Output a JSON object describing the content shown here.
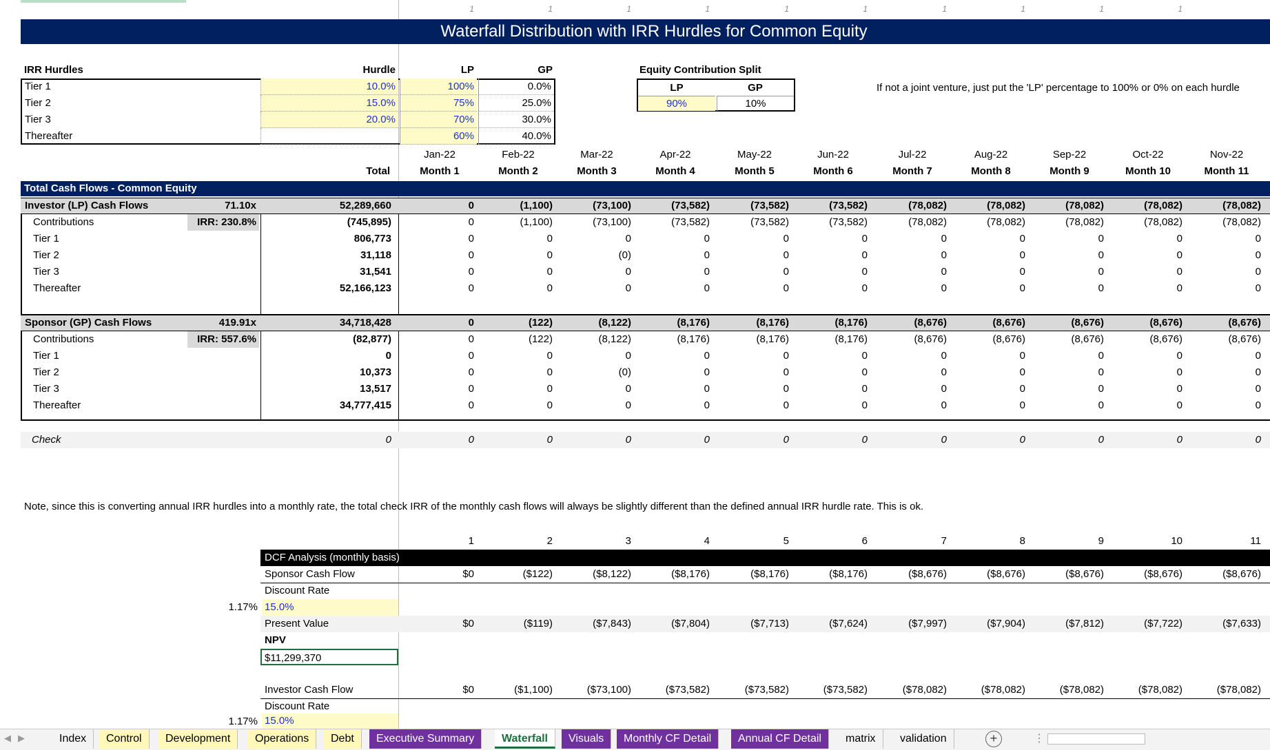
{
  "top_markers": [
    "1",
    "1",
    "1",
    "1",
    "1",
    "1",
    "1",
    "1",
    "1",
    "1"
  ],
  "title": "Waterfall Distribution with IRR Hurdles for Common Equity",
  "hurdles": {
    "header": {
      "label": "IRR Hurdles",
      "hurdle": "Hurdle",
      "lp": "LP",
      "gp": "GP"
    },
    "rows": [
      {
        "label": "Tier 1",
        "hurdle": "10.0%",
        "lp": "100%",
        "gp": "0.0%"
      },
      {
        "label": "Tier 2",
        "hurdle": "15.0%",
        "lp": "75%",
        "gp": "25.0%"
      },
      {
        "label": "Tier 3",
        "hurdle": "20.0%",
        "lp": "70%",
        "gp": "30.0%"
      },
      {
        "label": "Thereafter",
        "hurdle": "",
        "lp": "60%",
        "gp": "40.0%"
      }
    ]
  },
  "split": {
    "title": "Equity Contribution Split",
    "lp_label": "LP",
    "gp_label": "GP",
    "lp": "90%",
    "gp": "10%"
  },
  "note_jv": "If not a joint venture, just put the 'LP' percentage to 100% or 0% on each hurdle",
  "months": [
    "Jan-22",
    "Feb-22",
    "Mar-22",
    "Apr-22",
    "May-22",
    "Jun-22",
    "Jul-22",
    "Aug-22",
    "Sep-22",
    "Oct-22",
    "Nov-22"
  ],
  "month_labels": [
    "Month 1",
    "Month 2",
    "Month 3",
    "Month 4",
    "Month 5",
    "Month 6",
    "Month 7",
    "Month 8",
    "Month 9",
    "Month 10",
    "Month 11"
  ],
  "total_label": "Total",
  "section_title": "Total Cash Flows - Common Equity",
  "lp": {
    "header": {
      "label": "Investor (LP) Cash Flows",
      "multiple": "71.10x",
      "total": "52,289,660",
      "values": [
        "0",
        "(1,100)",
        "(73,100)",
        "(73,582)",
        "(73,582)",
        "(73,582)",
        "(78,082)",
        "(78,082)",
        "(78,082)",
        "(78,082)",
        "(78,082)"
      ]
    },
    "irr": "IRR: 230.8%",
    "rows": [
      {
        "label": "Contributions",
        "total": "(745,895)",
        "values": [
          "0",
          "(1,100)",
          "(73,100)",
          "(73,582)",
          "(73,582)",
          "(73,582)",
          "(78,082)",
          "(78,082)",
          "(78,082)",
          "(78,082)",
          "(78,082)"
        ]
      },
      {
        "label": "Tier 1",
        "total": "806,773",
        "values": [
          "0",
          "0",
          "0",
          "0",
          "0",
          "0",
          "0",
          "0",
          "0",
          "0",
          "0"
        ]
      },
      {
        "label": "Tier 2",
        "total": "31,118",
        "values": [
          "0",
          "0",
          "(0)",
          "0",
          "0",
          "0",
          "0",
          "0",
          "0",
          "0",
          "0"
        ]
      },
      {
        "label": "Tier 3",
        "total": "31,541",
        "values": [
          "0",
          "0",
          "0",
          "0",
          "0",
          "0",
          "0",
          "0",
          "0",
          "0",
          "0"
        ]
      },
      {
        "label": "Thereafter",
        "total": "52,166,123",
        "values": [
          "0",
          "0",
          "0",
          "0",
          "0",
          "0",
          "0",
          "0",
          "0",
          "0",
          "0"
        ]
      }
    ]
  },
  "gp": {
    "header": {
      "label": "Sponsor (GP) Cash Flows",
      "multiple": "419.91x",
      "total": "34,718,428",
      "values": [
        "0",
        "(122)",
        "(8,122)",
        "(8,176)",
        "(8,176)",
        "(8,176)",
        "(8,676)",
        "(8,676)",
        "(8,676)",
        "(8,676)",
        "(8,676)"
      ]
    },
    "irr": "IRR: 557.6%",
    "rows": [
      {
        "label": "Contributions",
        "total": "(82,877)",
        "values": [
          "0",
          "(122)",
          "(8,122)",
          "(8,176)",
          "(8,176)",
          "(8,176)",
          "(8,676)",
          "(8,676)",
          "(8,676)",
          "(8,676)",
          "(8,676)"
        ]
      },
      {
        "label": "Tier 1",
        "total": "0",
        "values": [
          "0",
          "0",
          "0",
          "0",
          "0",
          "0",
          "0",
          "0",
          "0",
          "0",
          "0"
        ]
      },
      {
        "label": "Tier 2",
        "total": "10,373",
        "values": [
          "0",
          "0",
          "(0)",
          "0",
          "0",
          "0",
          "0",
          "0",
          "0",
          "0",
          "0"
        ]
      },
      {
        "label": "Tier 3",
        "total": "13,517",
        "values": [
          "0",
          "0",
          "0",
          "0",
          "0",
          "0",
          "0",
          "0",
          "0",
          "0",
          "0"
        ]
      },
      {
        "label": "Thereafter",
        "total": "34,777,415",
        "values": [
          "0",
          "0",
          "0",
          "0",
          "0",
          "0",
          "0",
          "0",
          "0",
          "0",
          "0"
        ]
      }
    ]
  },
  "check": {
    "label": "Check",
    "total": "0",
    "values": [
      "0",
      "0",
      "0",
      "0",
      "0",
      "0",
      "0",
      "0",
      "0",
      "0",
      "0"
    ]
  },
  "note_irr": "Note, since this is converting annual IRR hurdles into a monthly rate, the total check IRR of the monthly cash flows will always be slightly different than the defined annual IRR hurdle rate. This is ok.",
  "period_numbers": [
    "1",
    "2",
    "3",
    "4",
    "5",
    "6",
    "7",
    "8",
    "9",
    "10",
    "11"
  ],
  "dcf": {
    "title": "DCF Analysis (monthly basis)",
    "sponsor_label": "Sponsor Cash Flow",
    "sponsor_values": [
      "$0",
      "($122)",
      "($8,122)",
      "($8,176)",
      "($8,176)",
      "($8,176)",
      "($8,676)",
      "($8,676)",
      "($8,676)",
      "($8,676)",
      "($8,676)"
    ],
    "discount_label": "Discount Rate",
    "monthly_rate": "1.17%",
    "discount_rate": "15.0%",
    "pv_label": "Present Value",
    "pv_values": [
      "$0",
      "($119)",
      "($7,843)",
      "($7,804)",
      "($7,713)",
      "($7,624)",
      "($7,997)",
      "($7,904)",
      "($7,812)",
      "($7,722)",
      "($7,633)"
    ],
    "npv_label": "NPV",
    "npv_value": "$11,299,370",
    "investor_label": "Investor Cash Flow",
    "investor_values": [
      "$0",
      "($1,100)",
      "($73,100)",
      "($73,582)",
      "($73,582)",
      "($73,582)",
      "($78,082)",
      "($78,082)",
      "($78,082)",
      "($78,082)",
      "($78,082)"
    ],
    "discount_label2": "Discount Rate",
    "monthly_rate2": "1.17%",
    "discount_rate2": "15.0%"
  },
  "tabs": [
    {
      "label": "Index",
      "style": "plain"
    },
    {
      "label": "Control",
      "style": "yellowtab"
    },
    {
      "label": "Development",
      "style": "yellowtab"
    },
    {
      "label": "Operations",
      "style": "yellowtab"
    },
    {
      "label": "Debt",
      "style": "yellowtab"
    },
    {
      "label": "Executive Summary",
      "style": "purple"
    },
    {
      "label": "Waterfall",
      "style": "active"
    },
    {
      "label": "Visuals",
      "style": "purple"
    },
    {
      "label": "Monthly CF Detail",
      "style": "purple"
    },
    {
      "label": "Annual CF Detail",
      "style": "purple"
    },
    {
      "label": "matrix",
      "style": "plain"
    },
    {
      "label": "validation",
      "style": "plain"
    }
  ],
  "colors": {
    "title_bg": "#002060",
    "accent_yellow": "#fffbc9",
    "input_blue": "#1f2fd6",
    "tab_purple": "#7030a0",
    "active_green": "#1e6e3c"
  }
}
